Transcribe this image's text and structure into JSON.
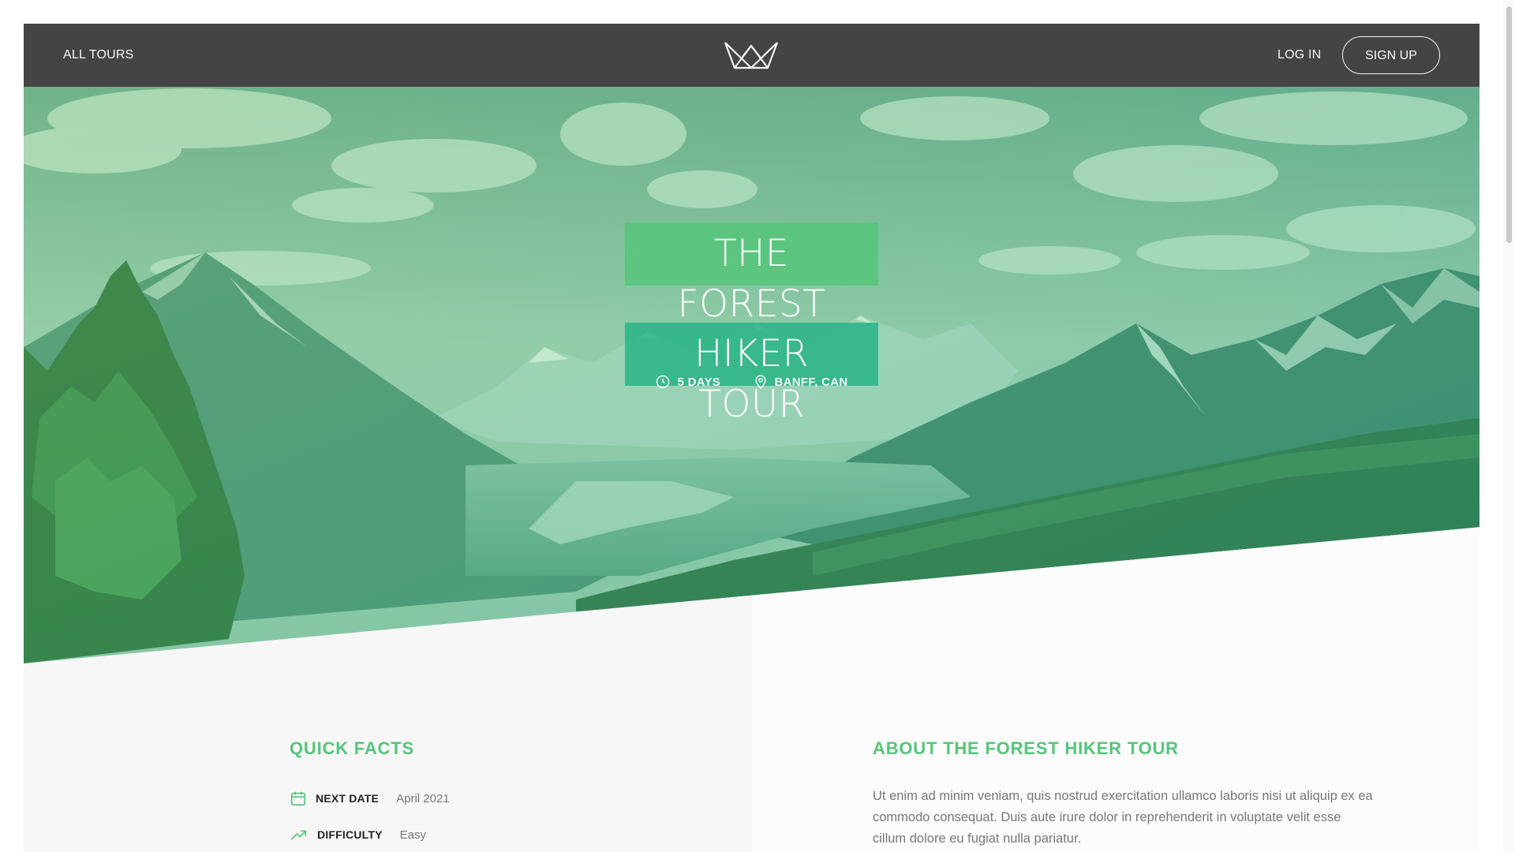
{
  "header": {
    "all_tours": "ALL TOURS",
    "login": "LOG IN",
    "signup": "SIGN UP",
    "logo_icon": "crown-logo-icon"
  },
  "hero": {
    "title_line1": "THE FOREST",
    "title_line2": "HIKER TOUR",
    "duration": "5 DAYS",
    "location": "BANFF, CAN",
    "duration_icon": "clock-icon",
    "location_icon": "map-pin-icon"
  },
  "quick_facts": {
    "heading": "QUICK FACTS",
    "items": [
      {
        "icon": "calendar-icon",
        "label": "NEXT DATE",
        "value": "April 2021"
      },
      {
        "icon": "trending-up-icon",
        "label": "DIFFICULTY",
        "value": "Easy"
      }
    ]
  },
  "about": {
    "heading": "ABOUT THE FOREST HIKER TOUR",
    "text": "Ut enim ad minim veniam, quis nostrud exercitation ullamco laboris nisi ut aliquip ex ea commodo consequat. Duis aute irure dolor in reprehenderit in voluptate velit esse cillum dolore eu fugiat nulla pariatur."
  },
  "colors": {
    "primary": "#55c57a",
    "primary_dark": "#28b485",
    "header_bg": "#444444",
    "page_bg": "#f7f7f7"
  }
}
